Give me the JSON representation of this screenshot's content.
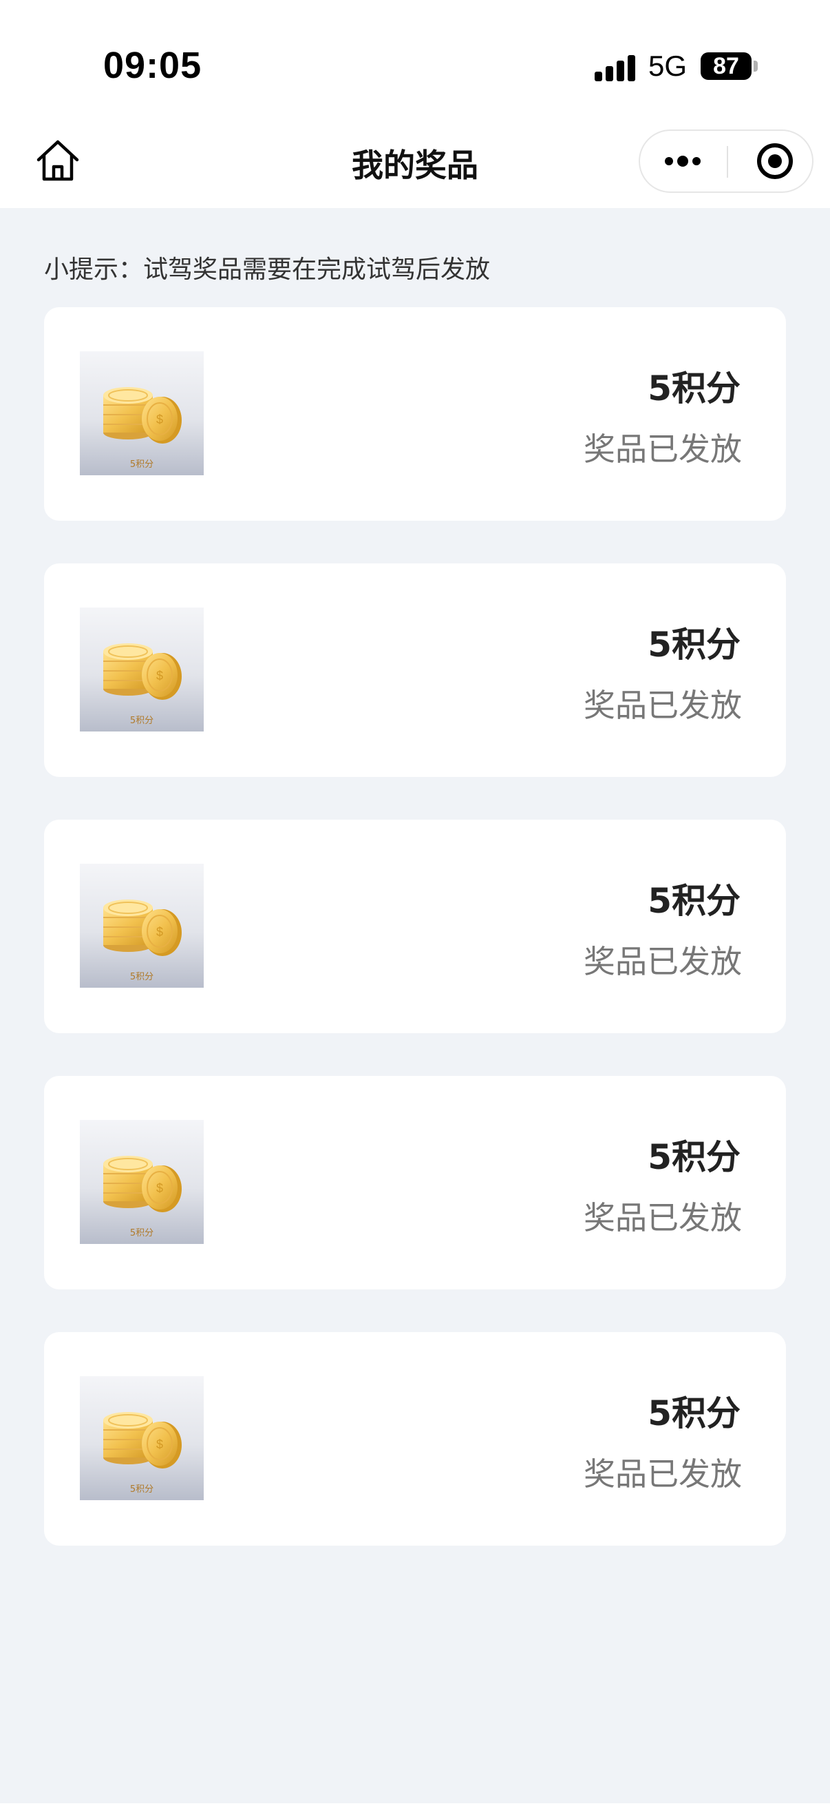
{
  "status_bar": {
    "time": "09:05",
    "network": "5G",
    "battery": "87"
  },
  "nav": {
    "title": "我的奖品",
    "home_icon": "home-icon",
    "more_icon": "more-dots-icon",
    "close_icon": "target-close-icon"
  },
  "tip": "小提示：试驾奖品需要在完成试驾后发放",
  "prizes": [
    {
      "name": "5积分",
      "status": "奖品已发放",
      "thumb_caption": "5积分"
    },
    {
      "name": "5积分",
      "status": "奖品已发放",
      "thumb_caption": "5积分"
    },
    {
      "name": "5积分",
      "status": "奖品已发放",
      "thumb_caption": "5积分"
    },
    {
      "name": "5积分",
      "status": "奖品已发放",
      "thumb_caption": "5积分"
    },
    {
      "name": "5积分",
      "status": "奖品已发放",
      "thumb_caption": "5积分"
    }
  ],
  "colors": {
    "page_background": "#f0f3f7",
    "card_background": "#ffffff",
    "coin_gold": "#f2c14e",
    "status_text": "#777777"
  }
}
